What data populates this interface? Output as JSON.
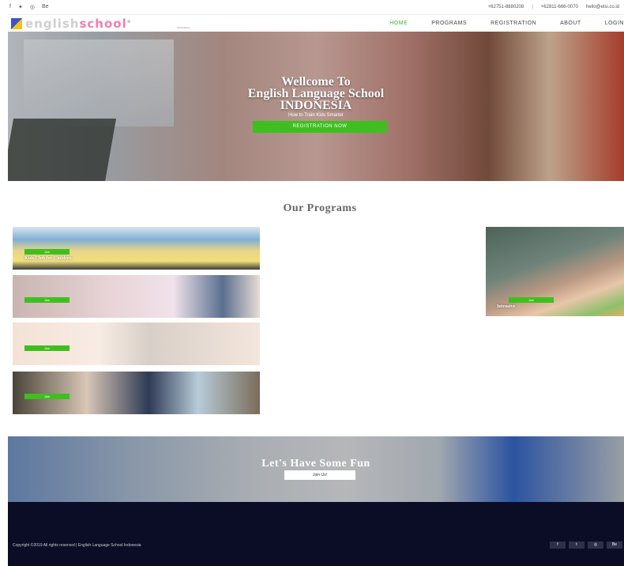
{
  "topbar": {
    "social_icons": [
      "facebook-icon",
      "twitter-icon",
      "instagram-icon",
      "behance-icon"
    ],
    "social_glyphs": [
      "f",
      "✦",
      "◎",
      "Be"
    ],
    "phone1": "+62751-8880208",
    "phone2": "+62811-666-0070",
    "email": "hello@elsi.co.id",
    "separator": "|"
  },
  "nav": {
    "logo_english": "english",
    "logo_school": "school",
    "logo_mark": "®",
    "logo_sub": "INDONESIA",
    "items": [
      "HOME",
      "PROGRAMS",
      "REGISTRATION",
      "ABOUT",
      "LOGIN"
    ]
  },
  "hero": {
    "title_line1": "Wellcome To",
    "title_line2": "English Language School",
    "title_line3": "INDONESIA",
    "subtitle": "How to Train Kids Smarter",
    "button": "REGISTRATION NOW"
  },
  "programs": {
    "title": "Our Programs",
    "cards": [
      {
        "label": "Kids Club for Children",
        "button": "Join"
      },
      {
        "label": "",
        "button": "Join"
      },
      {
        "label": "",
        "button": "Join"
      },
      {
        "label": "",
        "button": "Join"
      },
      {
        "label": "Intensive",
        "button": "Join"
      }
    ]
  },
  "fun": {
    "title": "Let's Have Some Fun",
    "button": "Join Us!"
  },
  "footer": {
    "copyright": "Copyright ©2019 All rights reserved | English Language School Indonesia",
    "social_glyphs": [
      "f",
      "t",
      "◎",
      "Be"
    ]
  },
  "colors": {
    "accent_green": "#3fbf1f",
    "nav_active": "#46b02a",
    "footer_bg": "#0a0d25"
  }
}
